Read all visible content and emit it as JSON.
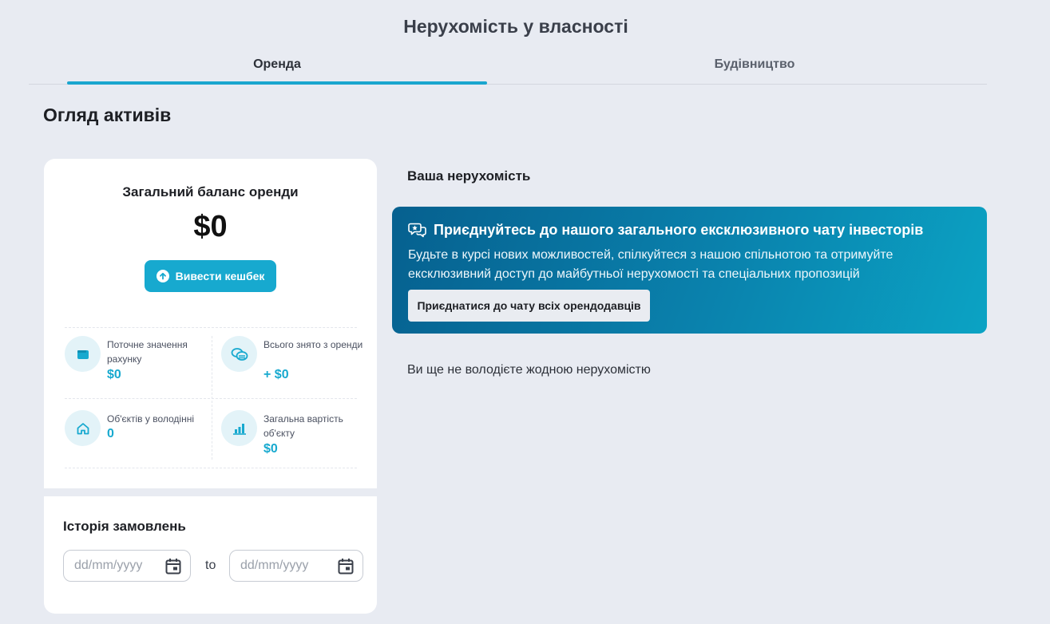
{
  "page": {
    "title": "Нерухомість у власності",
    "tabs": [
      {
        "label": "Оренда",
        "active": true
      },
      {
        "label": "Будівництво",
        "active": false
      }
    ],
    "section_title": "Огляд активів"
  },
  "balance": {
    "label": "Загальний баланс оренди",
    "value": "$0",
    "withdraw_button": "Вивести кешбек",
    "stats": [
      {
        "label": "Поточне значення рахунку",
        "value": "$0",
        "icon": "wallet-icon"
      },
      {
        "label": "Всього знято з оренди",
        "value": "+ $0",
        "icon": "coins-icon"
      },
      {
        "label": "Об'єктів у володінні",
        "value": "0",
        "icon": "house-icon"
      },
      {
        "label": "Загальна вартість об'єкту",
        "value": "$0",
        "icon": "bar-chart-icon"
      }
    ]
  },
  "history": {
    "title": "Історія замовлень",
    "from_placeholder": "dd/mm/yyyy",
    "to_label": "to",
    "to_placeholder": "dd/mm/yyyy"
  },
  "properties": {
    "title": "Ваша нерухомість",
    "promo": {
      "title": "Приєднуйтесь до нашого загального ексклюзивного чату інвесторів",
      "text": "Будьте в курсі нових можливостей, спілкуйтеся з нашою спільнотою та отримуйте ексклюзивний доступ до майбутньої нерухомості та спеціальних пропозицій",
      "button": "Приєднатися до чату всіх орендодавців",
      "icon": "chat-bubbles-icon"
    },
    "empty_message": "Ви ще не володієте жодною нерухомістю"
  },
  "colors": {
    "accent": "#17a9cf",
    "background": "#e8ebf2",
    "promo_gradient_start": "#06608f",
    "promo_gradient_end": "#0ba3c4"
  }
}
